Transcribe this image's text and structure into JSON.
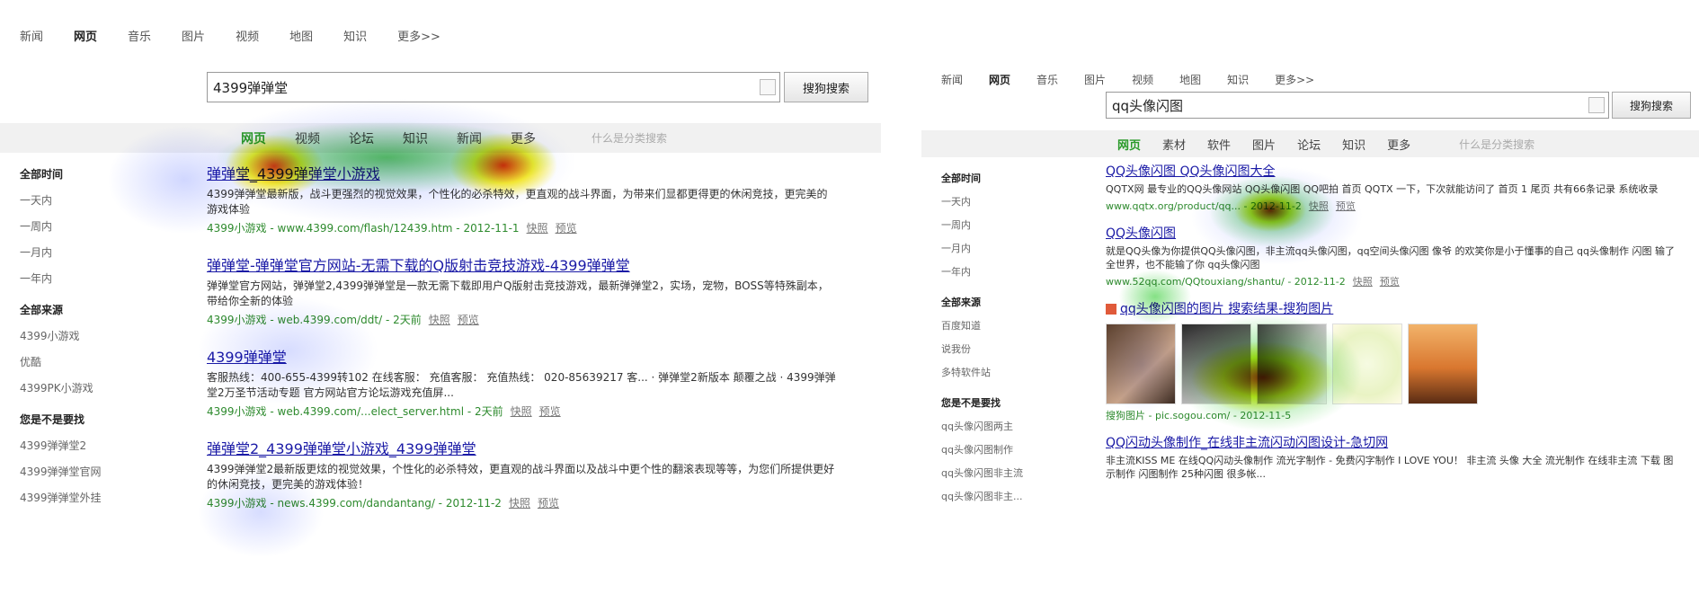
{
  "left": {
    "nav": [
      "新闻",
      "网页",
      "音乐",
      "图片",
      "视频",
      "地图",
      "知识",
      "更多>>"
    ],
    "nav_active": 1,
    "query": "4399弹弹堂",
    "search_button": "搜狗搜索",
    "tabs": [
      "网页",
      "视频",
      "论坛",
      "知识",
      "新闻",
      "更多"
    ],
    "tab_hint": "什么是分类搜索",
    "sidebar": [
      {
        "head": "全部时间",
        "items": [
          "一天内",
          "一周内",
          "一月内",
          "一年内"
        ]
      },
      {
        "head": "全部来源",
        "items": [
          "4399小游戏",
          "优酷",
          "4399PK小游戏"
        ]
      },
      {
        "head": "您是不是要找",
        "items": [
          "4399弹弹堂2",
          "4399弹弹堂官网",
          "4399弹弹堂外挂"
        ]
      }
    ],
    "results": [
      {
        "title": "弹弹堂_4399弹弹堂小游戏",
        "snippet": "4399弹弹堂最新版，战斗更强烈的视觉效果，个性化的必杀特效，更直观的战斗界面，为带来们显都更得更的休闲竞技，更完美的游戏体验",
        "url": "4399小游戏 - www.4399.com/flash/12439.htm - 2012-11-1",
        "links": [
          "快照",
          "预览"
        ]
      },
      {
        "title": "弹弹堂-弹弹堂官方网站-无需下载的Q版射击竞技游戏-4399弹弹堂",
        "snippet": "弹弹堂官方网站，弹弹堂2,4399弹弹堂是一款无需下载即用户Q版射击竞技游戏，最新弹弹堂2，实场，宠物，BOSS等特殊副本，带给你全新的体验",
        "url": "4399小游戏 - web.4399.com/ddt/ - 2天前",
        "links": [
          "快照",
          "预览"
        ]
      },
      {
        "title": "4399弹弹堂",
        "snippet": "客服热线：400-655-4399转102 在线客服： 充值客服： 充值热线： 020-85639217 客... · 弹弹堂2新版本 颠覆之战 · 4399弹弹堂2万圣节活动专题 官方网站官方论坛游戏充值屏...",
        "url": "4399小游戏 - web.4399.com/...elect_server.html - 2天前",
        "links": [
          "快照",
          "预览"
        ]
      },
      {
        "title": "弹弹堂2_4399弹弹堂小游戏_4399弹弹堂",
        "snippet": "4399弹弹堂2最新版更炫的视觉效果，个性化的必杀特效，更直观的战斗界面以及战斗中更个性的翻滚表现等等，为您们所提供更好的休闲竞技，更完美的游戏体验！",
        "url": "4399小游戏 - news.4399.com/dandantang/ - 2012-11-2",
        "links": [
          "快照",
          "预览"
        ]
      }
    ]
  },
  "right": {
    "nav": [
      "新闻",
      "网页",
      "音乐",
      "图片",
      "视频",
      "地图",
      "知识",
      "更多>>"
    ],
    "nav_active": 1,
    "query": "qq头像闪图",
    "search_button": "搜狗搜索",
    "tabs": [
      "网页",
      "素材",
      "软件",
      "图片",
      "论坛",
      "知识",
      "更多"
    ],
    "tab_hint": "什么是分类搜索",
    "sidebar": [
      {
        "head": "全部时间",
        "items": [
          "一天内",
          "一周内",
          "一月内",
          "一年内"
        ]
      },
      {
        "head": "全部来源",
        "items": [
          "百度知道",
          "说我份",
          "多特软件站"
        ]
      },
      {
        "head": "您是不是要找",
        "items": [
          "qq头像闪图两主",
          "qq头像闪图制作",
          "qq头像闪图非主流",
          "qq头像闪图非主..."
        ]
      }
    ],
    "results": [
      {
        "title": "QQ头像闪图 QQ头像闪图大全",
        "snippet": "QQTX网 最专业的QQ头像网站 QQ头像闪图 QQ吧拍 首页 QQTX 一下，下次就能访问了 首页 1 尾页 共有66条记录 系统收录",
        "url": "www.qqtx.org/product/qq... - 2012-11-2",
        "links": [
          "快照",
          "预览"
        ]
      },
      {
        "title": "QQ头像闪图",
        "snippet": "就是QQ头像为你提供QQ头像闪图，非主流qq头像闪图，qq空间头像闪图 像爷 的欢笑你是小于懂事的自己 qq头像制作 闪图 输了全世界，也不能输了你 qq头像闪图",
        "url": "www.52qq.com/QQtouxiang/shantu/ - 2012-11-2",
        "links": [
          "快照",
          "预览"
        ]
      },
      {
        "title": "qq头像闪图的图片 搜索结果-搜狗图片",
        "is_images": true,
        "url": "搜狗图片 - pic.sogou.com/ - 2012-11-5",
        "links": []
      },
      {
        "title": "QQ闪动头像制作_在线非主流闪动闪图设计-急切网",
        "snippet": "非主流KISS ME 在线QQ闪动头像制作 流光字制作 - 免费闪字制作 I LOVE YOU！ 非主流 头像 大全 流光制作 在线非主流 下载 图示制作 闪图制作 25种闪图 很多帐...",
        "url": "",
        "links": []
      }
    ]
  },
  "colors": {
    "link": "#1a1aa6",
    "url_green": "#2d8a2d",
    "tab_active": "#2a9a2a",
    "band_bg": "#f1f1f1",
    "heat_red": "#ff2a00",
    "heat_yellow": "#ffee00",
    "heat_green": "#33cc33",
    "heat_blue": "#7a8cff"
  }
}
